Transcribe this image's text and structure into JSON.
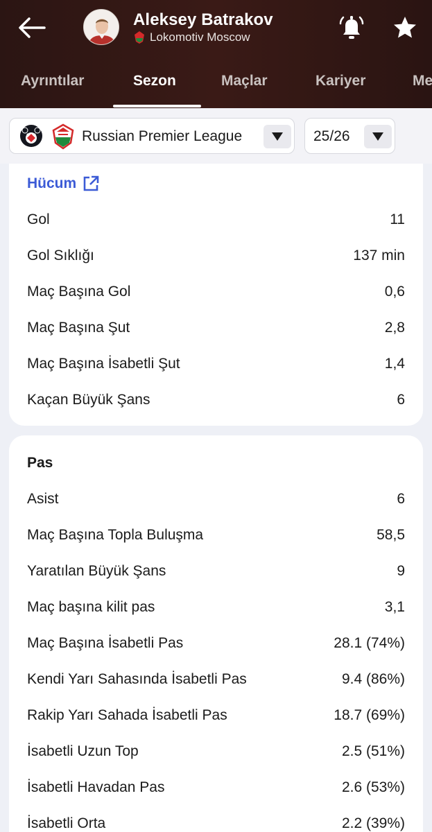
{
  "header": {
    "player_name": "Aleksey Batrakov",
    "team_name": "Lokomotiv Moscow",
    "background_color": "#2b1513"
  },
  "tabs": [
    {
      "label": "Ayrıntılar",
      "active": false
    },
    {
      "label": "Sezon",
      "active": true
    },
    {
      "label": "Maçlar",
      "active": false
    },
    {
      "label": "Kariyer",
      "active": false
    },
    {
      "label": "Me",
      "active": false
    }
  ],
  "filters": {
    "league": "Russian Premier League",
    "season": "25/26"
  },
  "attack": {
    "title": "Hücum",
    "rows": [
      {
        "label": "Gol",
        "value": "11"
      },
      {
        "label": "Gol Sıklığı",
        "value": "137 min"
      },
      {
        "label": "Maç Başına Gol",
        "value": "0,6"
      },
      {
        "label": "Maç Başına Şut",
        "value": "2,8"
      },
      {
        "label": "Maç Başına İsabetli Şut",
        "value": "1,4"
      },
      {
        "label": "Kaçan Büyük Şans",
        "value": "6"
      }
    ]
  },
  "pass": {
    "title": "Pas",
    "rows": [
      {
        "label": "Asist",
        "value": "6"
      },
      {
        "label": "Maç Başına Topla Buluşma",
        "value": "58,5"
      },
      {
        "label": "Yaratılan Büyük Şans",
        "value": "9"
      },
      {
        "label": "Maç başına kilit pas",
        "value": "3,1"
      },
      {
        "label": "Maç Başına İsabetli Pas",
        "value": "28.1 (74%)"
      },
      {
        "label": "Kendi Yarı Sahasında İsabetli Pas",
        "value": "9.4 (86%)"
      },
      {
        "label": "Rakip Yarı Sahada İsabetli Pas",
        "value": "18.7 (69%)"
      },
      {
        "label": "İsabetli Uzun Top",
        "value": "2.5 (51%)"
      },
      {
        "label": "İsabetli Havadan Pas",
        "value": "2.6 (53%)"
      },
      {
        "label": "İsabetli Orta",
        "value": "2.2 (39%)"
      }
    ]
  },
  "colors": {
    "accent_link": "#3c5bd6",
    "page_bg": "#eef0f6",
    "card_bg": "#ffffff"
  }
}
